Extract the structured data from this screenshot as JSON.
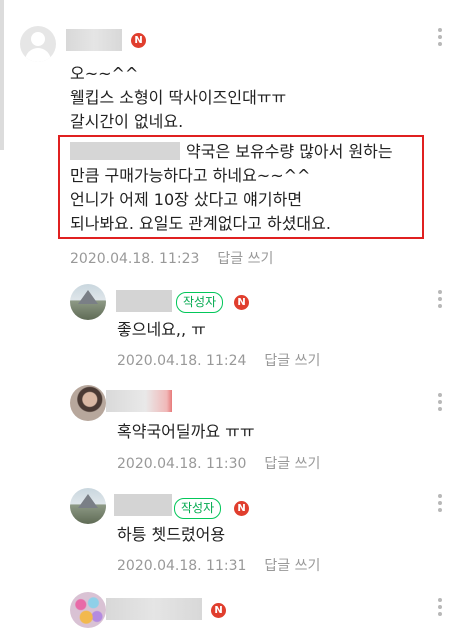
{
  "badge_new": "N",
  "author_tag": "작성자",
  "reply_label": "답글 쓰기",
  "comments": [
    {
      "lines": [
        "오~~^^",
        "웰킵스 소형이 딱사이즈인대ㅠㅠ",
        "갈시간이 없네요."
      ],
      "highlight_lines": [
        "약국은 보유수량 많아서 원하는",
        "만큼 구매가능하다고 하네요~~^^",
        "언니가 어제 10장 샀다고 얘기하면",
        "되나봐요. 요일도 관계없다고 하셨대요."
      ],
      "date": "2020.04.18. 11:23"
    },
    {
      "text": "좋으네요,, ㅠ",
      "date": "2020.04.18. 11:24"
    },
    {
      "text": "혹약국어딜까요 ㅠㅠ",
      "date": "2020.04.18. 11:30"
    },
    {
      "text": "하틍  쳇드렸어용",
      "date": "2020.04.18. 11:31"
    }
  ],
  "colors": {
    "accent": "#03c75a",
    "badge": "#e03e2e",
    "highlight_border": "#e02020",
    "meta": "#999999"
  }
}
